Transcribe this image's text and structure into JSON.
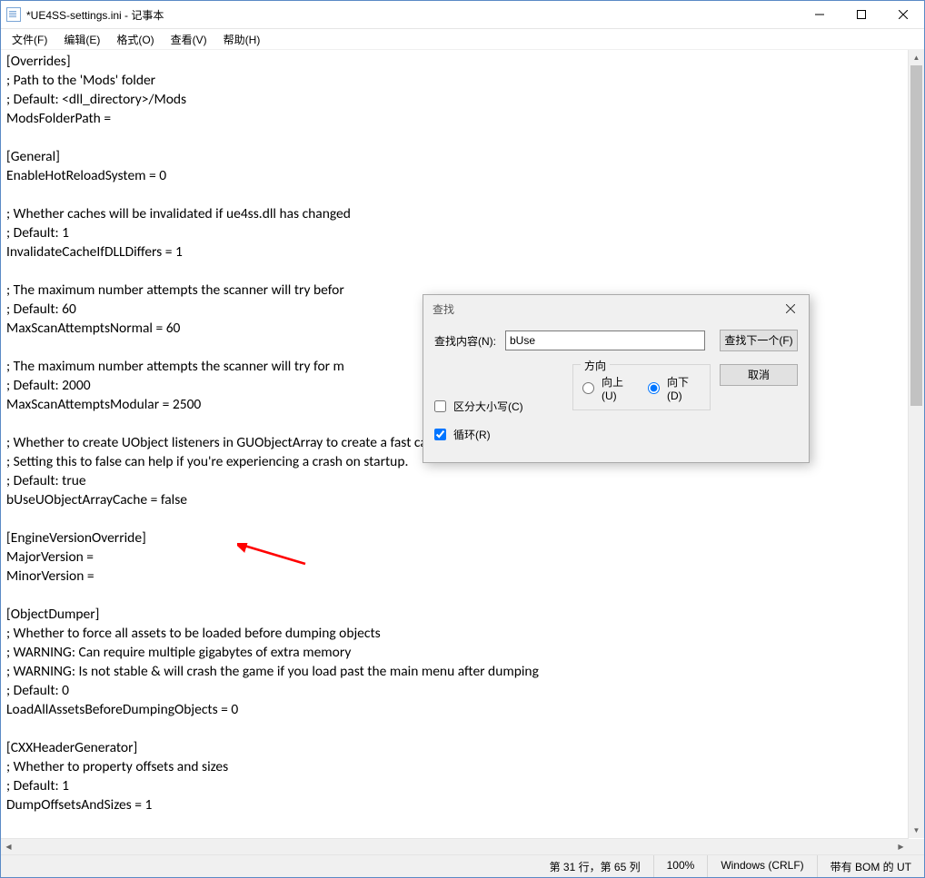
{
  "window": {
    "title": "*UE4SS-settings.ini - 记事本"
  },
  "menu": {
    "file": "文件(F)",
    "edit": "编辑(E)",
    "format": "格式(O)",
    "view": "查看(V)",
    "help": "帮助(H)"
  },
  "editor": {
    "content": "[Overrides]\n; Path to the 'Mods' folder\n; Default: <dll_directory>/Mods\nModsFolderPath =\n\n[General]\nEnableHotReloadSystem = 0\n\n; Whether caches will be invalidated if ue4ss.dll has changed\n; Default: 1\nInvalidateCacheIfDLLDiffers = 1\n\n; The maximum number attempts the scanner will try befor\n; Default: 60\nMaxScanAttemptsNormal = 60\n\n; The maximum number attempts the scanner will try for m\n; Default: 2000\nMaxScanAttemptsModular = 2500\n\n; Whether to create UObject listeners in GUObjectArray to create a fast cache for use instead of iterating GUObjectArray.\n; Setting this to false can help if you're experiencing a crash on startup.\n; Default: true\nbUseUObjectArrayCache = false\n\n[EngineVersionOverride]\nMajorVersion =\nMinorVersion =\n\n[ObjectDumper]\n; Whether to force all assets to be loaded before dumping objects\n; WARNING: Can require multiple gigabytes of extra memory\n; WARNING: Is not stable & will crash the game if you load past the main menu after dumping\n; Default: 0\nLoadAllAssetsBeforeDumpingObjects = 0\n\n[CXXHeaderGenerator]\n; Whether to property offsets and sizes\n; Default: 1\nDumpOffsetsAndSizes = 1\n"
  },
  "find": {
    "title": "查找",
    "search_label": "查找内容(N):",
    "search_value": "bUse",
    "find_next": "查找下一个(F)",
    "cancel": "取消",
    "match_case": "区分大小写(C)",
    "wrap": "循环(R)",
    "direction_label": "方向",
    "dir_up": "向上(U)",
    "dir_down": "向下(D)"
  },
  "status": {
    "position": "第 31 行，第 65 列",
    "zoom": "100%",
    "eol": "Windows (CRLF)",
    "encoding": "带有 BOM 的 UT"
  }
}
